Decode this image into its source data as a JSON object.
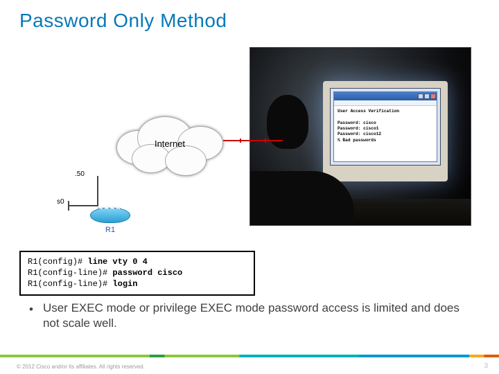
{
  "title": "Password Only Method",
  "diagram": {
    "cloud_label": "Internet",
    "if_label_a": ".50",
    "if_label_b": "s0",
    "router_name": "R1"
  },
  "terminal": {
    "heading": "User Access Verification",
    "lines": [
      "Password: cisco",
      "Password: cisco1",
      "Password: cisco12",
      "% Bad passwords"
    ]
  },
  "cli": {
    "p1": "R1(config)# ",
    "c1": "line vty 0 4",
    "p2": "R1(config-line)# ",
    "c2": "password cisco",
    "p3": "R1(config-line)# ",
    "c3": "login"
  },
  "bullet": "User EXEC mode or privilege EXEC mode password access is limited and does not scale well.",
  "footer": {
    "copyright": "© 2012 Cisco and/or its affiliates. All rights reserved.",
    "page": "3"
  }
}
